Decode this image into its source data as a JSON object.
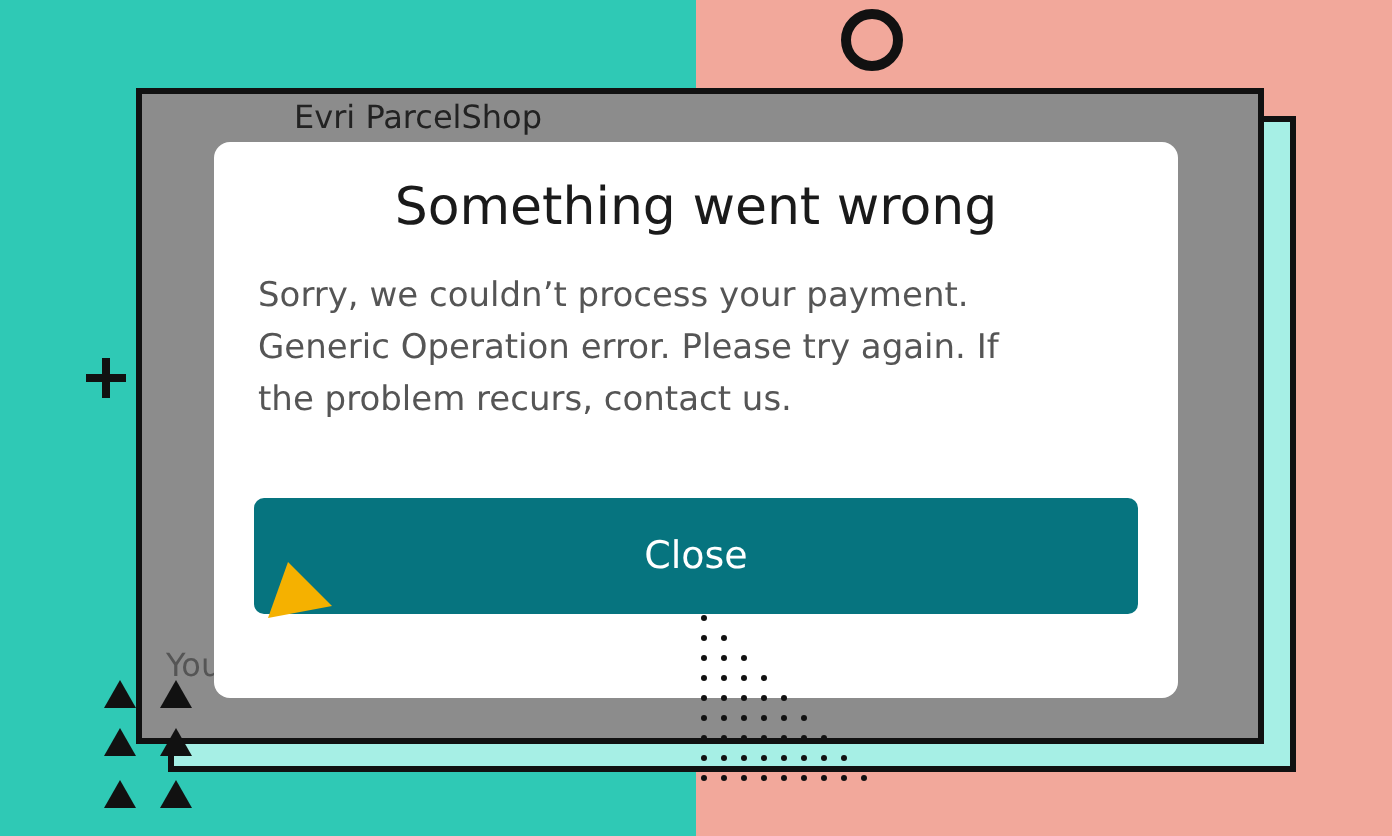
{
  "app_window": {
    "title": "Evri ParcelShop",
    "footer_text": "You"
  },
  "dialog": {
    "title": "Something went wrong",
    "message": "Sorry, we couldn’t process your payment. Generic Operation error. Please try again. If the problem recurs, contact us.",
    "button": "Close"
  }
}
